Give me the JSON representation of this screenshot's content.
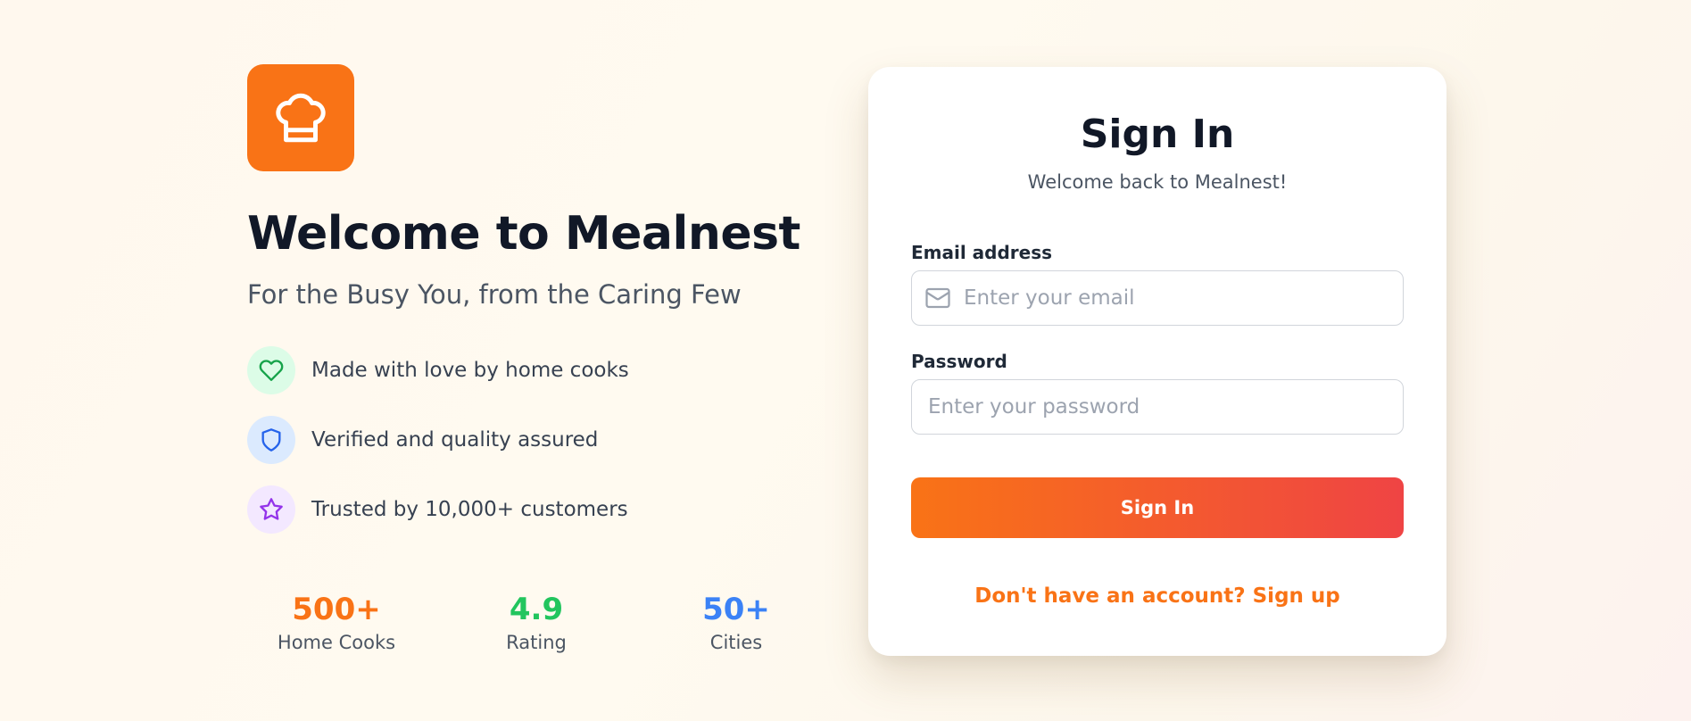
{
  "brand": {
    "headline": "Welcome to Mealnest",
    "tagline": "For the Busy You, from the Caring Few",
    "logo_icon": "chef-hat-icon",
    "accent_color": "#f97316"
  },
  "features": [
    {
      "icon": "heart-icon",
      "text": "Made with love by home cooks",
      "color": "#16a34a"
    },
    {
      "icon": "shield-icon",
      "text": "Verified and quality assured",
      "color": "#2563eb"
    },
    {
      "icon": "star-icon",
      "text": "Trusted by 10,000+ customers",
      "color": "#9333ea"
    }
  ],
  "stats": [
    {
      "value": "500+",
      "label": "Home Cooks",
      "color": "#f97316"
    },
    {
      "value": "4.9",
      "label": "Rating",
      "color": "#22c55e"
    },
    {
      "value": "50+",
      "label": "Cities",
      "color": "#3b82f6"
    }
  ],
  "signin": {
    "title": "Sign In",
    "subtitle": "Welcome back to Mealnest!",
    "email_label": "Email address",
    "email_placeholder": "Enter your email",
    "email_icon": "mail-icon",
    "password_label": "Password",
    "password_placeholder": "Enter your password",
    "button_label": "Sign In",
    "signup_link": "Don't have an account? Sign up"
  }
}
